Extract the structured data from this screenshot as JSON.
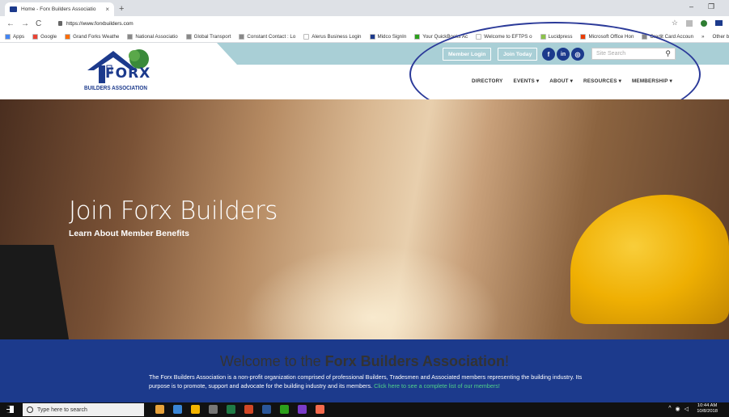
{
  "browser": {
    "tab_title": "Home - Forx Builders Associatio",
    "tab_close": "×",
    "new_tab": "+",
    "url": "https://www.forxbuilders.com",
    "minimize": "–",
    "restore": "❐",
    "nav_back": "←",
    "nav_forward": "→",
    "nav_reload": "C",
    "star": "☆",
    "bookmarks": [
      {
        "label": "Apps",
        "color": "#4285f4"
      },
      {
        "label": "Google",
        "color": "#ea4335"
      },
      {
        "label": "Grand Forks Weathe",
        "color": "#ff6d00"
      },
      {
        "label": "National Associatio",
        "color": "#888888"
      },
      {
        "label": "Global Transport",
        "color": "#888888"
      },
      {
        "label": "Constant Contact : Lo",
        "color": "#888888"
      },
      {
        "label": "Alerus Business Login",
        "color": "#ffffff"
      },
      {
        "label": "Midco SignIn",
        "color": "#1c3a8c"
      },
      {
        "label": "Your QuickBooks Ac",
        "color": "#2ca01c"
      },
      {
        "label": "Welcome to EFTPS o",
        "color": "#ffffff"
      },
      {
        "label": "Lucidpress",
        "color": "#8bc34a"
      },
      {
        "label": "Microsoft Office Hon",
        "color": "#eb3c00"
      },
      {
        "label": "Credit Card Accoun",
        "color": "#888888"
      }
    ],
    "bookmarks_more": "»",
    "other_bookmarks": "Other bookma"
  },
  "site": {
    "logo_text": "BUILDERS ASSOCIATION",
    "logo_word": "FORX",
    "member_login": "Member Login",
    "join_today": "Join Today",
    "social": [
      "f",
      "in",
      "◎"
    ],
    "search_placeholder": "Site Search",
    "search_icon": "⚲",
    "nav": [
      "DIRECTORY",
      "EVENTS ▾",
      "ABOUT ▾",
      "RESOURCES ▾",
      "MEMBERSHIP ▾"
    ]
  },
  "hero": {
    "title": "Join Forx Builders",
    "subtitle": "Learn About Member Benefits"
  },
  "welcome": {
    "title_prefix": "Welcome to the ",
    "title_bold": "Forx Builders Association",
    "title_suffix": "!",
    "text": "The Forx Builders Association is a non-profit organization comprised of professional Builders, Tradesmen and Associated members representing the building industry. Its purpose is to promote, support and advocate for the building industry and its members. ",
    "link": "Click here to see a complete list of our members!"
  },
  "taskbar": {
    "search_placeholder": "Type here to search",
    "time": "10:44 AM",
    "date": "10/8/2018",
    "apps": [
      "#e8a33b",
      "#3a86d6",
      "#f4b400",
      "#777777",
      "#1f7a45",
      "#d24726",
      "#2b579a",
      "#2ca01c",
      "#7a3cc8",
      "#f56a4d"
    ]
  }
}
